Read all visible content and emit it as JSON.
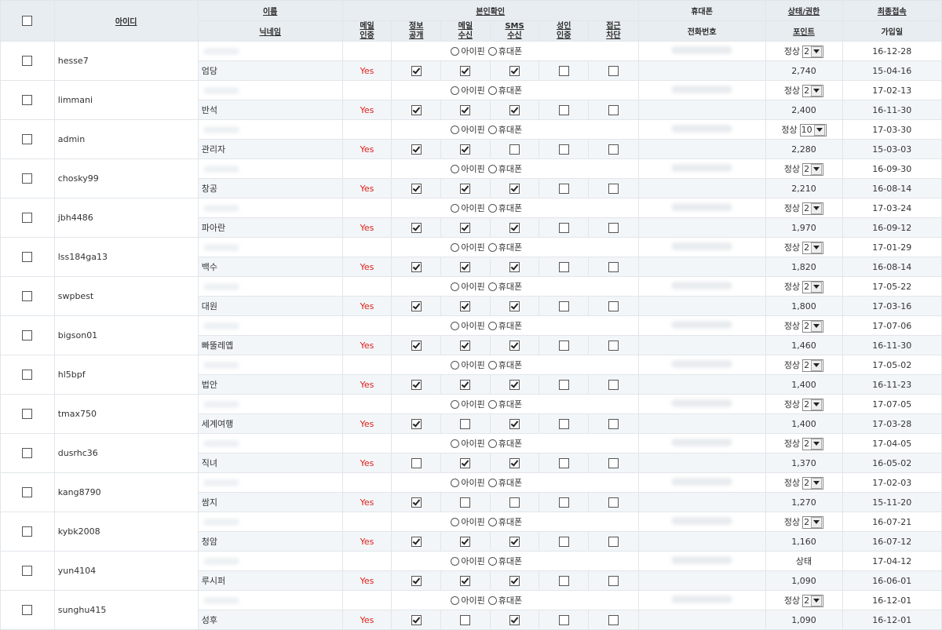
{
  "header": {
    "row1": {
      "id": "아이디",
      "name": "이름",
      "verify": "본인확인",
      "phone": "휴대폰",
      "status": "상태/권한",
      "last_login": "최종접속"
    },
    "row2": {
      "nickname": "닉네임",
      "mail_verify": [
        "메일",
        "인증"
      ],
      "info_public": [
        "정보",
        "공개"
      ],
      "mail_recv": [
        "메일",
        "수신"
      ],
      "sms_recv": [
        "SMS",
        "수신"
      ],
      "adult_verify": [
        "성인",
        "인증"
      ],
      "block": [
        "접근",
        "차단"
      ],
      "phone_no": "전화번호",
      "point": "포인트",
      "join_date": "가입일"
    }
  },
  "radio_labels": {
    "ipin": "아이핀",
    "phone": "휴대폰"
  },
  "yes_label": "Yes",
  "members": [
    {
      "id": "hesse7",
      "nick": "엄당",
      "status": "정상",
      "level": "2",
      "point": "2,740",
      "last": "16-12-28",
      "join": "15-04-16",
      "info": true,
      "mail": true,
      "sms": true,
      "adult": false,
      "block": false,
      "status_label": true
    },
    {
      "id": "limmani",
      "nick": "반석",
      "status": "정상",
      "level": "2",
      "point": "2,400",
      "last": "17-02-13",
      "join": "16-11-30",
      "info": true,
      "mail": true,
      "sms": true,
      "adult": false,
      "block": false
    },
    {
      "id": "admin",
      "nick": "관리자",
      "status": "정상",
      "level": "10",
      "point": "2,280",
      "last": "17-03-30",
      "join": "15-03-03",
      "info": true,
      "mail": true,
      "sms": false,
      "adult": false,
      "block": false
    },
    {
      "id": "chosky99",
      "nick": "창공",
      "status": "정상",
      "level": "2",
      "point": "2,210",
      "last": "16-09-30",
      "join": "16-08-14",
      "info": true,
      "mail": true,
      "sms": true,
      "adult": false,
      "block": false
    },
    {
      "id": "jbh4486",
      "nick": "파아란",
      "status": "정상",
      "level": "2",
      "point": "1,970",
      "last": "17-03-24",
      "join": "16-09-12",
      "info": true,
      "mail": true,
      "sms": true,
      "adult": false,
      "block": false
    },
    {
      "id": "lss184ga13",
      "nick": "백수",
      "status": "정상",
      "level": "2",
      "point": "1,820",
      "last": "17-01-29",
      "join": "16-08-14",
      "info": true,
      "mail": true,
      "sms": true,
      "adult": false,
      "block": false
    },
    {
      "id": "swpbest",
      "nick": "대원",
      "status": "정상",
      "level": "2",
      "point": "1,800",
      "last": "17-05-22",
      "join": "17-03-16",
      "info": true,
      "mail": true,
      "sms": true,
      "adult": false,
      "block": false
    },
    {
      "id": "bigson01",
      "nick": "빠뚤레옙",
      "status": "정상",
      "level": "2",
      "point": "1,460",
      "last": "17-07-06",
      "join": "16-11-30",
      "info": true,
      "mail": true,
      "sms": true,
      "adult": false,
      "block": false
    },
    {
      "id": "hl5bpf",
      "nick": "법안",
      "status": "정상",
      "level": "2",
      "point": "1,400",
      "last": "17-05-02",
      "join": "16-11-23",
      "info": true,
      "mail": true,
      "sms": true,
      "adult": false,
      "block": false
    },
    {
      "id": "tmax750",
      "nick": "세계여행",
      "status": "정상",
      "level": "2",
      "point": "1,400",
      "last": "17-07-05",
      "join": "17-03-28",
      "info": true,
      "mail": false,
      "sms": true,
      "adult": false,
      "block": false
    },
    {
      "id": "dusrhc36",
      "nick": "직녀",
      "status": "정상",
      "level": "2",
      "point": "1,370",
      "last": "17-04-05",
      "join": "16-05-02",
      "info": false,
      "mail": true,
      "sms": true,
      "adult": false,
      "block": false
    },
    {
      "id": "kang8790",
      "nick": "쌈지",
      "status": "정상",
      "level": "2",
      "point": "1,270",
      "last": "17-02-03",
      "join": "15-11-20",
      "info": true,
      "mail": false,
      "sms": false,
      "adult": false,
      "block": false
    },
    {
      "id": "kybk2008",
      "nick": "청암",
      "status": "정상",
      "level": "2",
      "point": "1,160",
      "last": "16-07-21",
      "join": "16-07-12",
      "info": true,
      "mail": true,
      "sms": true,
      "adult": false,
      "block": false
    },
    {
      "id": "yun4104",
      "nick": "루시퍼",
      "status": "상태",
      "level": "",
      "point": "1,090",
      "last": "17-04-12",
      "join": "16-06-01",
      "info": true,
      "mail": true,
      "sms": true,
      "adult": false,
      "block": false
    },
    {
      "id": "sunghu415",
      "nick": "성후",
      "status": "정상",
      "level": "2",
      "point": "1,090",
      "last": "16-12-01",
      "join": "16-12-01",
      "info": true,
      "mail": false,
      "sms": true,
      "adult": false,
      "block": false
    }
  ]
}
